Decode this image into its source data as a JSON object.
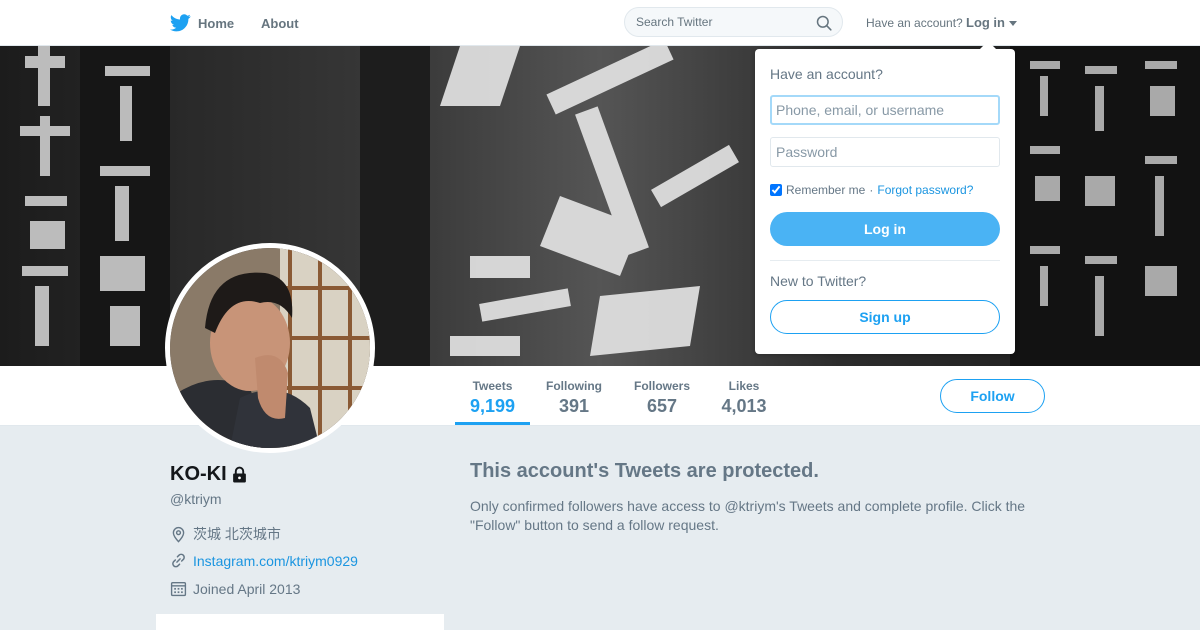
{
  "nav": {
    "home_label": "Home",
    "about_label": "About",
    "search_placeholder": "Search Twitter",
    "login_prompt": "Have an account?",
    "login_label": "Log in"
  },
  "login_dropdown": {
    "title": "Have an account?",
    "username_placeholder": "Phone, email, or username",
    "password_placeholder": "Password",
    "remember_label": "Remember me",
    "separator": "·",
    "forgot_label": "Forgot password?",
    "login_button": "Log in",
    "new_prompt": "New to Twitter?",
    "signup_button": "Sign up"
  },
  "profile": {
    "name": "KO-KI",
    "handle": "@ktriym",
    "location": "茨城 北茨城市",
    "website": "Instagram.com/ktriym0929",
    "joined": "Joined April 2013"
  },
  "stats": [
    {
      "label": "Tweets",
      "value": "9,199"
    },
    {
      "label": "Following",
      "value": "391"
    },
    {
      "label": "Followers",
      "value": "657"
    },
    {
      "label": "Likes",
      "value": "4,013"
    }
  ],
  "follow_button": "Follow",
  "protected": {
    "title": "This account's Tweets are protected.",
    "body": "Only confirmed followers have access to @ktriym's Tweets and complete profile. Click the \"Follow\" button to send a follow request."
  },
  "colors": {
    "brand": "#1da1f2",
    "background": "#e6ecf0",
    "muted_text": "#657786"
  }
}
